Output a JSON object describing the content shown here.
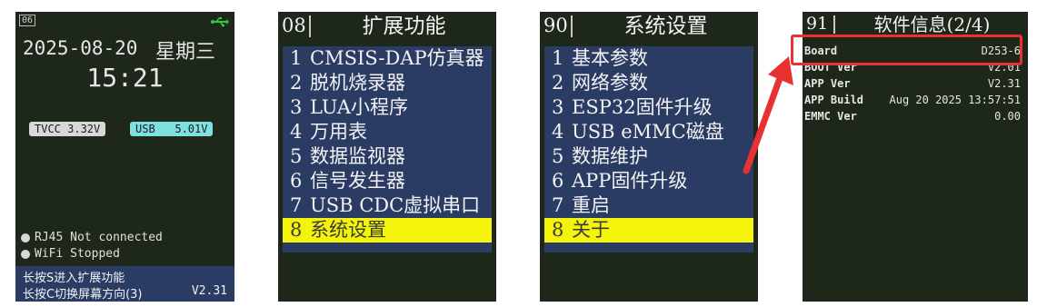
{
  "home": {
    "page_number": "06",
    "usb_icon": "usb-icon",
    "date": "2025-08-20",
    "weekday": "星期三",
    "time": "15:21",
    "tvcc": "TVCC 3.32V",
    "usb": "USB   5.01V",
    "rj45": "RJ45 Not connected",
    "wifi": "WiFi Stopped",
    "hint1": "长按S进入扩展功能",
    "hint2": "长按C切换屏幕方向(3)",
    "version": "V2.31"
  },
  "ext_menu": {
    "page_number": "08",
    "title": "扩展功能",
    "items": [
      {
        "n": "1",
        "label": "CMSIS-DAP仿真器"
      },
      {
        "n": "2",
        "label": "脱机烧录器"
      },
      {
        "n": "3",
        "label": "LUA小程序"
      },
      {
        "n": "4",
        "label": "万用表"
      },
      {
        "n": "5",
        "label": "数据监视器"
      },
      {
        "n": "6",
        "label": "信号发生器"
      },
      {
        "n": "7",
        "label": "USB CDC虚拟串口"
      },
      {
        "n": "8",
        "label": "系统设置"
      }
    ]
  },
  "sys_menu": {
    "page_number": "90",
    "title": "系统设置",
    "items": [
      {
        "n": "1",
        "label": "基本参数"
      },
      {
        "n": "2",
        "label": "网络参数"
      },
      {
        "n": "3",
        "label": "ESP32固件升级"
      },
      {
        "n": "4",
        "label": "USB eMMC磁盘"
      },
      {
        "n": "5",
        "label": "数据维护"
      },
      {
        "n": "6",
        "label": "APP固件升级"
      },
      {
        "n": "7",
        "label": "重启"
      },
      {
        "n": "8",
        "label": "关于"
      }
    ]
  },
  "info": {
    "page_number": "91",
    "title": "软件信息(2/4)",
    "rows": [
      {
        "key": "Board",
        "value": "D253-6"
      },
      {
        "key": "BOOT Ver",
        "value": "V2.01"
      },
      {
        "key": "APP Ver",
        "value": "V2.31"
      },
      {
        "key": "APP Build",
        "value": "Aug 20 2025 13:57:51"
      },
      {
        "key": "EMMC Ver",
        "value": "0.00"
      }
    ]
  },
  "colors": {
    "screen_bg": "#1d271a",
    "menu_bg": "#2a3c64",
    "highlight": "#f4f40a",
    "usb_green": "#2ecc40",
    "tvcc_pill": "#d8d8d8",
    "usb_pill": "#7fe0e0",
    "annotation_red": "#e83232"
  }
}
